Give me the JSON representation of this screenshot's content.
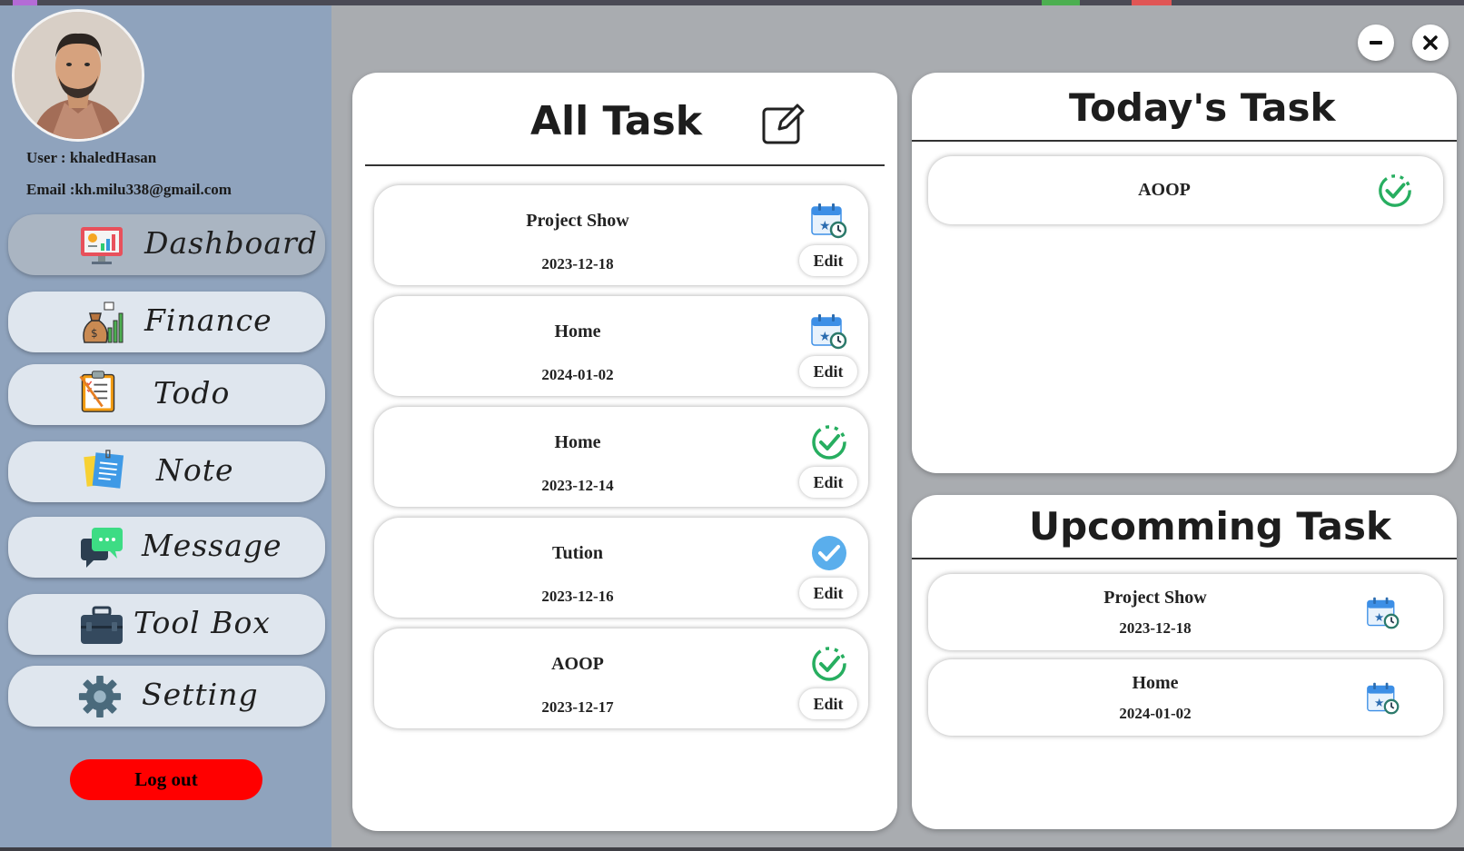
{
  "user": {
    "line": "User : khaledHasan",
    "email_line": "Email :kh.milu338@gmail.com"
  },
  "nav": [
    {
      "label": "Dashboard",
      "icon": "dashboard-icon",
      "active": true
    },
    {
      "label": "Finance",
      "icon": "money-bag-chart-icon",
      "active": false
    },
    {
      "label": "Todo",
      "icon": "clipboard-checklist-icon",
      "active": false
    },
    {
      "label": "Note",
      "icon": "sticky-note-icon",
      "active": false
    },
    {
      "label": "Message",
      "icon": "chat-bubbles-icon",
      "active": false
    },
    {
      "label": "Tool Box",
      "icon": "toolbox-icon",
      "active": false
    },
    {
      "label": "Setting",
      "icon": "gear-icon",
      "active": false
    }
  ],
  "logout_label": "Log out",
  "all_task": {
    "title": "All Task",
    "edit_label": "Edit",
    "items": [
      {
        "title": "Project Show",
        "date": "2023-12-18",
        "status_icon": "calendar-clock-icon"
      },
      {
        "title": "Home",
        "date": "2024-01-02",
        "status_icon": "calendar-clock-icon"
      },
      {
        "title": "Home",
        "date": "2023-12-14",
        "status_icon": "progress-check-icon"
      },
      {
        "title": "Tution",
        "date": "2023-12-16",
        "status_icon": "done-check-icon"
      },
      {
        "title": "AOOP",
        "date": "2023-12-17",
        "status_icon": "progress-check-icon"
      }
    ]
  },
  "today_task": {
    "title": "Today's Task",
    "items": [
      {
        "title": "AOOP",
        "status_icon": "progress-check-icon"
      }
    ]
  },
  "upcoming_task": {
    "title": "Upcomming Task",
    "items": [
      {
        "title": "Project Show",
        "date": "2023-12-18",
        "status_icon": "calendar-clock-icon"
      },
      {
        "title": "Home",
        "date": "2024-01-02",
        "status_icon": "calendar-clock-icon"
      }
    ]
  },
  "colors": {
    "sidebar_bg": "#8fa3bd",
    "nav_bg": "#dfe6ee",
    "nav_active_bg": "#aab5c2",
    "logout_bg": "#ff0000",
    "check_green": "#27ae60",
    "done_blue": "#5aaeec"
  }
}
